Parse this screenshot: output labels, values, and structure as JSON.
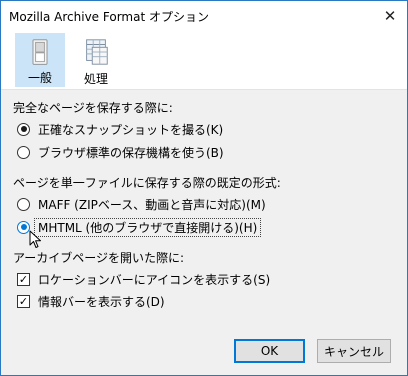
{
  "window": {
    "title": "Mozilla Archive Format オプション"
  },
  "toolbar": {
    "items": [
      {
        "label": "一般",
        "icon": "general-switch-icon",
        "selected": true
      },
      {
        "label": "処理",
        "icon": "processing-grid-icon",
        "selected": false
      }
    ]
  },
  "save_section": {
    "heading": "完全なページを保存する際に:",
    "options": [
      {
        "label": "正確なスナップショットを撮る(K)",
        "checked": true
      },
      {
        "label": "ブラウザ標準の保存機構を使う(B)",
        "checked": false
      }
    ]
  },
  "format_section": {
    "heading": "ページを単一ファイルに保存する際の既定の形式:",
    "options": [
      {
        "label": "MAFF (ZIPベース、動画と音声に対応)(M)",
        "checked": false
      },
      {
        "label": "MHTML (他のブラウザで直接開ける)(H)",
        "checked": true
      }
    ]
  },
  "archive_section": {
    "heading": "アーカイブページを開いた際に:",
    "options": [
      {
        "label": "ロケーションバーにアイコンを表示する(S)",
        "checked": true
      },
      {
        "label": "情報バーを表示する(D)",
        "checked": true
      }
    ]
  },
  "buttons": {
    "ok": "OK",
    "cancel": "キャンセル"
  },
  "colors": {
    "accent": "#0078d7",
    "selected_tab": "#cce4f7",
    "content_bg": "#f0f0f0"
  }
}
